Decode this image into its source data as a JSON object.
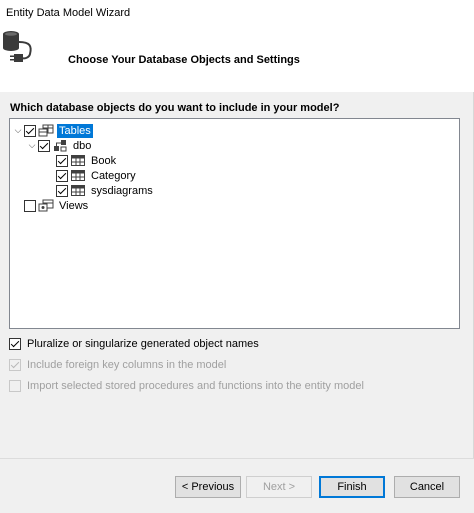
{
  "window": {
    "title": "Entity Data Model Wizard"
  },
  "header": {
    "title": "Choose Your Database Objects and Settings",
    "icon": "database-plug-icon"
  },
  "question": "Which database objects do you want to include in your model?",
  "tree": {
    "tables": {
      "label": "Tables",
      "checked": true,
      "expanded": true
    },
    "dbo": {
      "label": "dbo",
      "checked": true,
      "expanded": true
    },
    "items": [
      {
        "label": "Book",
        "checked": true
      },
      {
        "label": "Category",
        "checked": true
      },
      {
        "label": "sysdiagrams",
        "checked": true
      }
    ],
    "views": {
      "label": "Views",
      "checked": false
    }
  },
  "options": {
    "pluralize": {
      "label": "Pluralize or singularize generated object names",
      "checked": true,
      "enabled": true
    },
    "foreign_keys": {
      "label": "Include foreign key columns in the model",
      "checked": true,
      "enabled": false
    },
    "stored_procs": {
      "label": "Import selected stored procedures and functions into the entity model",
      "checked": false,
      "enabled": false
    }
  },
  "buttons": {
    "previous": "< Previous",
    "next": "Next >",
    "finish": "Finish",
    "cancel": "Cancel"
  },
  "colors": {
    "selection": "#0078d7",
    "accent": "#0078d7"
  }
}
